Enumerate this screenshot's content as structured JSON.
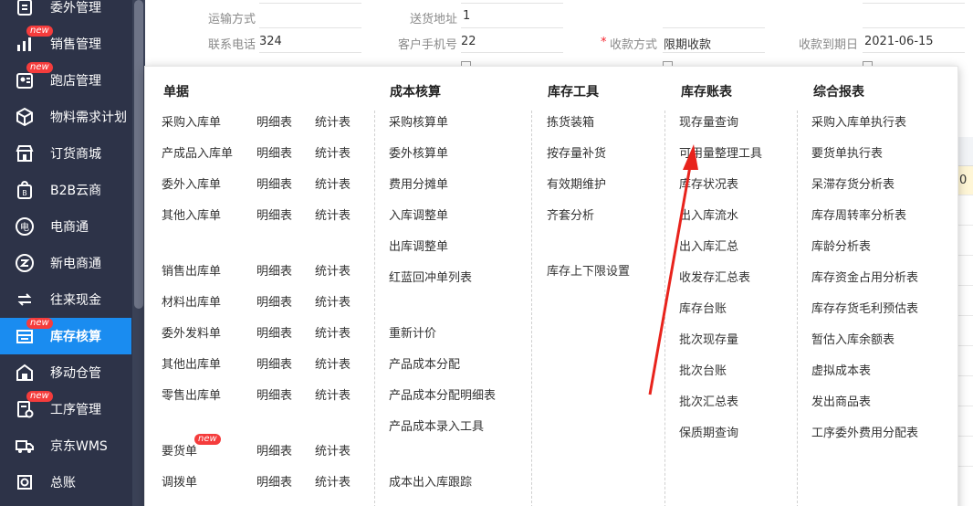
{
  "sidebar": {
    "items": [
      {
        "label": "委外管理",
        "icon": "outsource-icon",
        "new": false
      },
      {
        "label": "销售管理",
        "icon": "sales-chart-icon",
        "new": true
      },
      {
        "label": "跑店管理",
        "icon": "store-visit-icon",
        "new": true
      },
      {
        "label": "物料需求计划",
        "icon": "cube-icon",
        "new": false
      },
      {
        "label": "订货商城",
        "icon": "shop-icon",
        "new": false
      },
      {
        "label": "B2B云商",
        "icon": "b2b-bag-icon",
        "new": false
      },
      {
        "label": "电商通",
        "icon": "ecommerce-icon",
        "new": false
      },
      {
        "label": "新电商通",
        "icon": "new-ecommerce-icon",
        "new": false
      },
      {
        "label": "往来现金",
        "icon": "exchange-icon",
        "new": false
      },
      {
        "label": "库存核算",
        "icon": "inventory-icon",
        "new": true,
        "active": true
      },
      {
        "label": "移动仓管",
        "icon": "mobile-warehouse-icon",
        "new": false
      },
      {
        "label": "工序管理",
        "icon": "process-icon",
        "new": true
      },
      {
        "label": "京东WMS",
        "icon": "truck-icon",
        "new": false
      },
      {
        "label": "总账",
        "icon": "ledger-icon",
        "new": false
      }
    ],
    "new_label": "new",
    "accent": "#1a8cf0",
    "bg": "#2d3348"
  },
  "form": {
    "transport_label": "运输方式",
    "address_label": "送货地址",
    "address_value": "1",
    "phone_label": "联系电话",
    "phone_value": "324",
    "mobile_label": "客户手机号",
    "mobile_value": "22",
    "payment_label": "收款方式",
    "payment_value": "限期收款",
    "due_label": "收款到期日",
    "due_value": "2021-06-15",
    "required_mark": "*",
    "table_edge_value": "0"
  },
  "menu": {
    "col1": {
      "title": "单据",
      "detail_label": "明细表",
      "stat_label": "统计表",
      "rows": [
        "采购入库单",
        "产成品入库单",
        "委外入库单",
        "其他入库单",
        "销售出库单",
        "材料出库单",
        "委外发料单",
        "其他出库单",
        "零售出库单",
        "要货单",
        "调拨单"
      ],
      "new_badge": "new"
    },
    "col2": {
      "title": "成本核算",
      "items": [
        "采购核算单",
        "委外核算单",
        "费用分摊单",
        "入库调整单",
        "出库调整单",
        "红蓝回冲单列表",
        "重新计价",
        "产品成本分配",
        "产品成本分配明细表",
        "产品成本录入工具",
        "成本出入库跟踪"
      ]
    },
    "col3": {
      "title": "库存工具",
      "items": [
        "拣货装箱",
        "按存量补货",
        "有效期维护",
        "齐套分析",
        "库存上下限设置"
      ]
    },
    "col4": {
      "title": "库存账表",
      "items": [
        "现存量查询",
        "可用量整理工具",
        "库存状况表",
        "出入库流水",
        "出入库汇总",
        "收发存汇总表",
        "库存台账",
        "批次现存量",
        "批次台账",
        "批次汇总表",
        "保质期查询"
      ]
    },
    "col5": {
      "title": "综合报表",
      "items": [
        "采购入库单执行表",
        "要货单执行表",
        "呆滞存货分析表",
        "库存周转率分析表",
        "库龄分析表",
        "库存资金占用分析表",
        "库存存货毛利预估表",
        "暂估入库余额表",
        "虚拟成本表",
        "发出商品表",
        "工序委外费用分配表"
      ]
    },
    "annotation_color": "#e8231c"
  }
}
